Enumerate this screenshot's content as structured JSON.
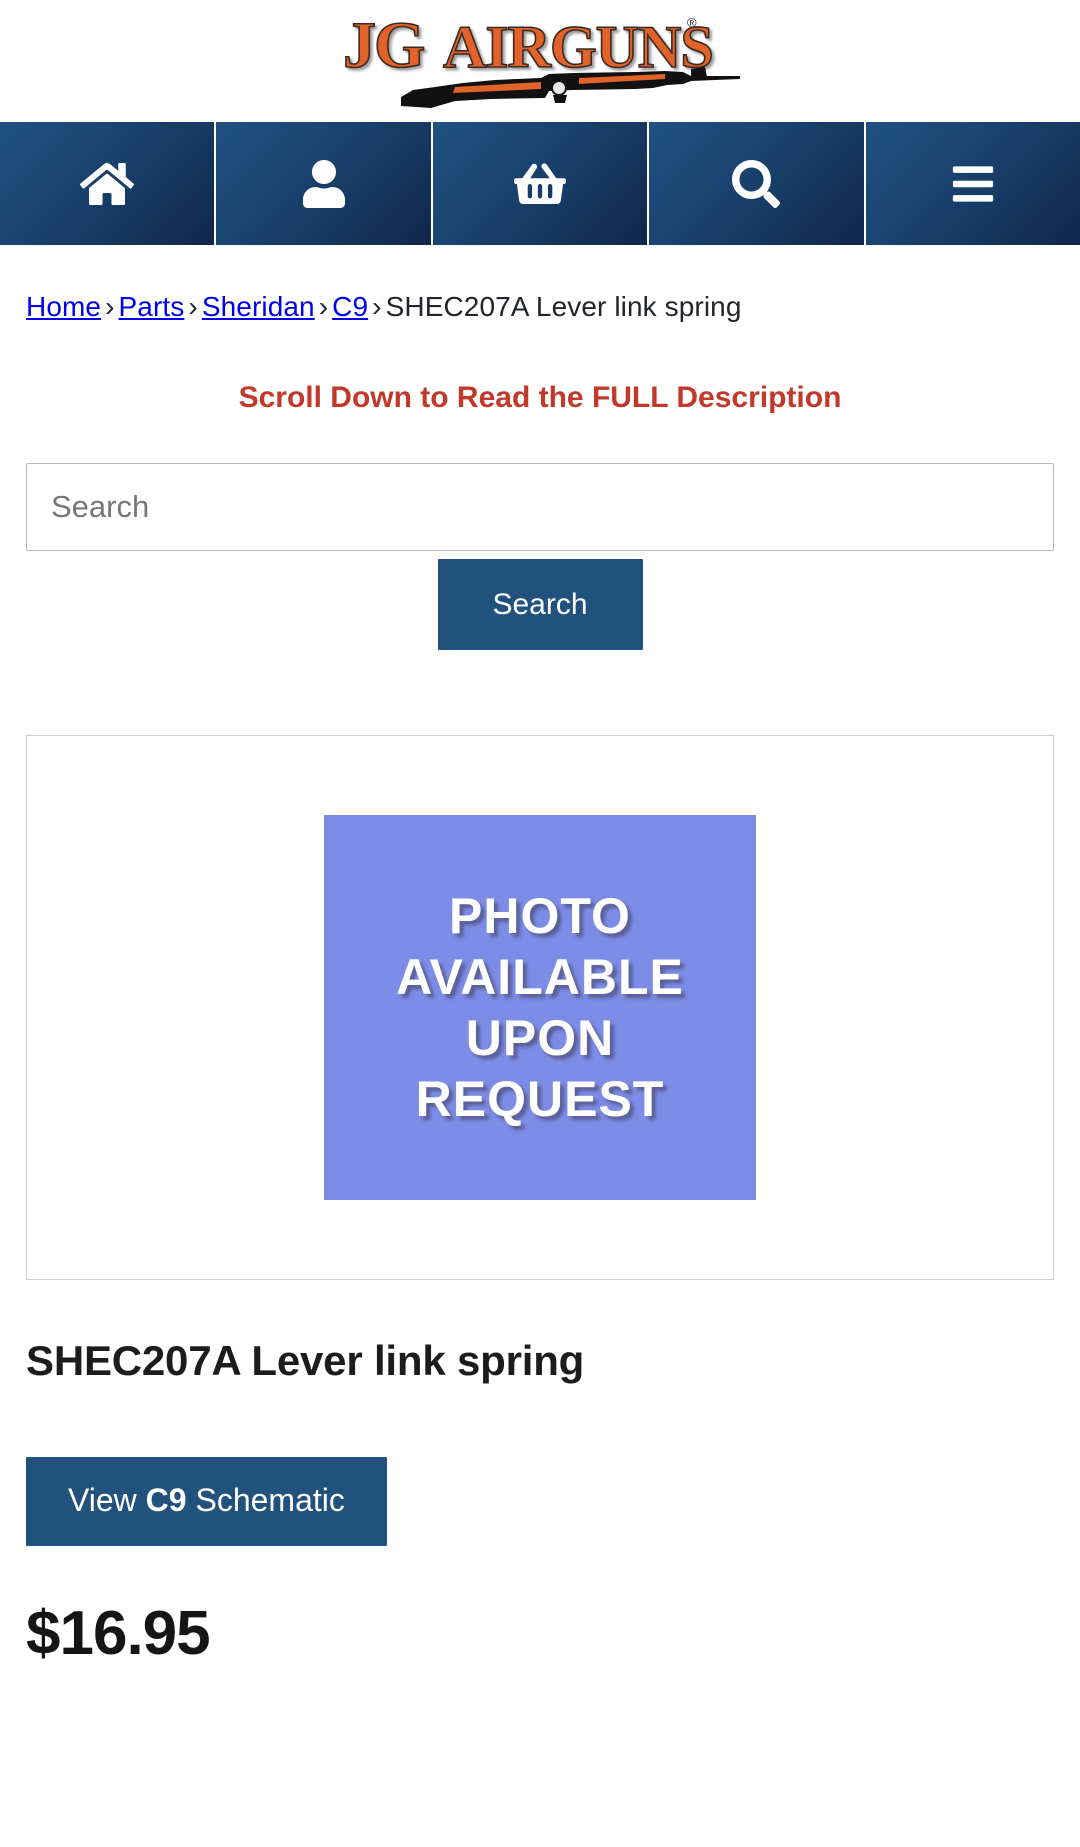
{
  "site": {
    "logo_text_primary": "JG",
    "logo_text_secondary": "AIRGUNS",
    "logo_trademark": "®",
    "logo_alt": "JG Airguns"
  },
  "nav": {
    "items": [
      {
        "icon": "home-icon",
        "label": "Home"
      },
      {
        "icon": "user-icon",
        "label": "Account"
      },
      {
        "icon": "basket-icon",
        "label": "Cart"
      },
      {
        "icon": "search-icon",
        "label": "Search"
      },
      {
        "icon": "hamburger-menu-icon",
        "label": "Menu"
      }
    ]
  },
  "breadcrumb": {
    "separator": "›",
    "items": [
      "Home",
      "Parts",
      "Sheridan",
      "C9",
      "SHEC207A Lever link spring"
    ]
  },
  "notice": {
    "text": "Scroll Down to Read the FULL Description",
    "color": "#c0392b"
  },
  "search": {
    "value": "",
    "placeholder": "Search",
    "button_label": "Search"
  },
  "product": {
    "image_placeholder_lines": [
      "PHOTO",
      "AVAILABLE",
      "UPON",
      "REQUEST"
    ],
    "image_placeholder_bg": "#7d8ce6",
    "title": "SHEC207A Lever link spring",
    "schematic_button": {
      "prefix": "View ",
      "model": "C9",
      "suffix": " Schematic"
    },
    "price": "$16.95"
  },
  "colors": {
    "nav_blue_light": "#205182",
    "nav_blue_dark": "#11264b",
    "button_blue": "#21517d",
    "accent_red": "#c0392b",
    "logo_orange": "#e2622b"
  }
}
